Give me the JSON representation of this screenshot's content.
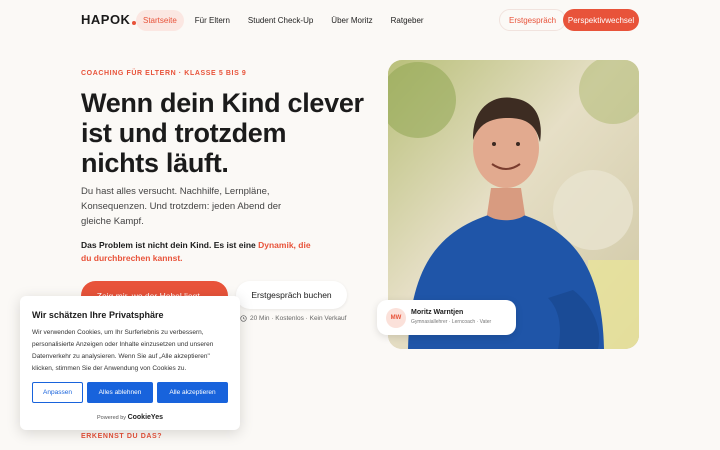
{
  "header": {
    "logo": "HAPOK",
    "nav": [
      "Startseite",
      "Für Eltern",
      "Student Check-Up",
      "Über Moritz",
      "Ratgeber"
    ],
    "active_nav": "Startseite",
    "btn_secondary": "Erstgespräch",
    "btn_primary": "Perspektivwechsel"
  },
  "hero": {
    "eyebrow": "COACHING FÜR ELTERN · KLASSE 5 BIS 9",
    "title": "Wenn dein Kind clever ist und trotzdem nichts läuft.",
    "body": "Du hast alles versucht. Nachhilfe, Lernpläne, Konsequenzen. Und trotzdem: jeden Abend der gleiche Kampf.",
    "problem_prefix": "Das Problem ist nicht dein Kind. Es ist eine ",
    "problem_accent": "Dynamik, die du durchbrechen kannst.",
    "cta_primary": "Zeig mir, wo der Hebel liegt",
    "cta_primary_arrow": "→",
    "cta_secondary": "Erstgespräch buchen",
    "meta": "20 Min · Kostenlos · Kein Verkauf",
    "meta_icon": "clock-icon"
  },
  "section_label": "ERKENNST DU DAS?",
  "person_card": {
    "initials": "MW",
    "name": "Moritz Warntjen",
    "role": "Gymnasiallehrer · Lerncoach · Vater"
  },
  "cookie": {
    "title": "Wir schätzen Ihre Privatsphäre",
    "text": "Wir verwenden Cookies, um Ihr Surferlebnis zu verbessern, personalisierte Anzeigen oder Inhalte einzusetzen und unseren Datenverkehr zu analysieren. Wenn Sie auf „Alle akzeptieren\" klicken, stimmen Sie der Anwendung von Cookies zu.",
    "btn_customize": "Anpassen",
    "btn_reject": "Alles ablehnen",
    "btn_accept": "Alle akzeptieren",
    "powered_by": "Powered by",
    "brand": "CookieYes"
  },
  "colors": {
    "accent": "#e8533a",
    "cookie_blue": "#1863dc",
    "background": "#fbf9f6"
  }
}
